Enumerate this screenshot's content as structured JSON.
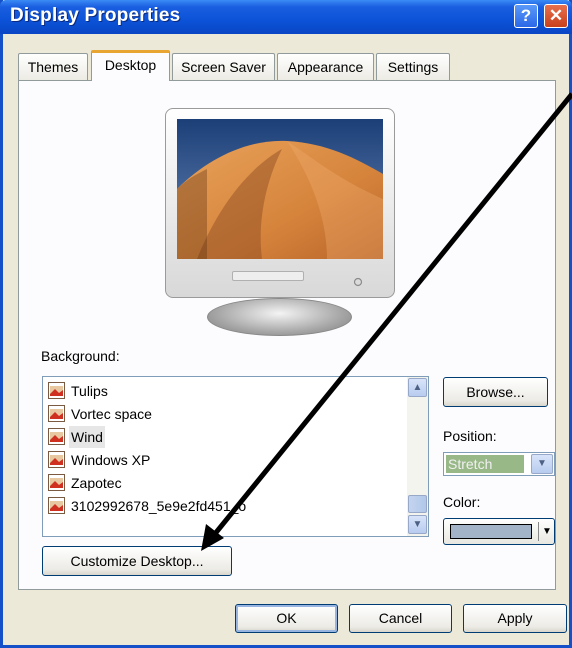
{
  "window": {
    "title": "Display Properties",
    "help_glyph": "?",
    "close_glyph": "✕"
  },
  "tabs": [
    {
      "label": "Themes",
      "active": false
    },
    {
      "label": "Desktop",
      "active": true
    },
    {
      "label": "Screen Saver",
      "active": false
    },
    {
      "label": "Appearance",
      "active": false
    },
    {
      "label": "Settings",
      "active": false
    }
  ],
  "desktop": {
    "background_label": "Background:",
    "background_list": [
      {
        "name": "Tulips",
        "selected": false
      },
      {
        "name": "Vortec space",
        "selected": false
      },
      {
        "name": "Wind",
        "selected": true
      },
      {
        "name": "Windows XP",
        "selected": false
      },
      {
        "name": "Zapotec",
        "selected": false
      },
      {
        "name": "3102992678_5e9e2fd451_o",
        "selected": false
      }
    ],
    "browse_label": "Browse...",
    "position_label": "Position:",
    "position_value": "Stretch",
    "color_label": "Color:",
    "color_value": "#a4b4c8",
    "customize_label": "Customize Desktop..."
  },
  "footer": {
    "ok_label": "OK",
    "cancel_label": "Cancel",
    "apply_label": "Apply"
  },
  "icons": {
    "help": "question-icon",
    "close": "close-icon",
    "list_item": "image-file-icon",
    "scroll_up": "chevron-up-icon",
    "scroll_down": "chevron-down-icon",
    "dropdown": "chevron-down-icon"
  },
  "colors": {
    "titlebar": "#0b52d8",
    "window_bg": "#ece9d8",
    "active_tab_accent": "#e8a532",
    "disabled_select": "#98b888"
  }
}
